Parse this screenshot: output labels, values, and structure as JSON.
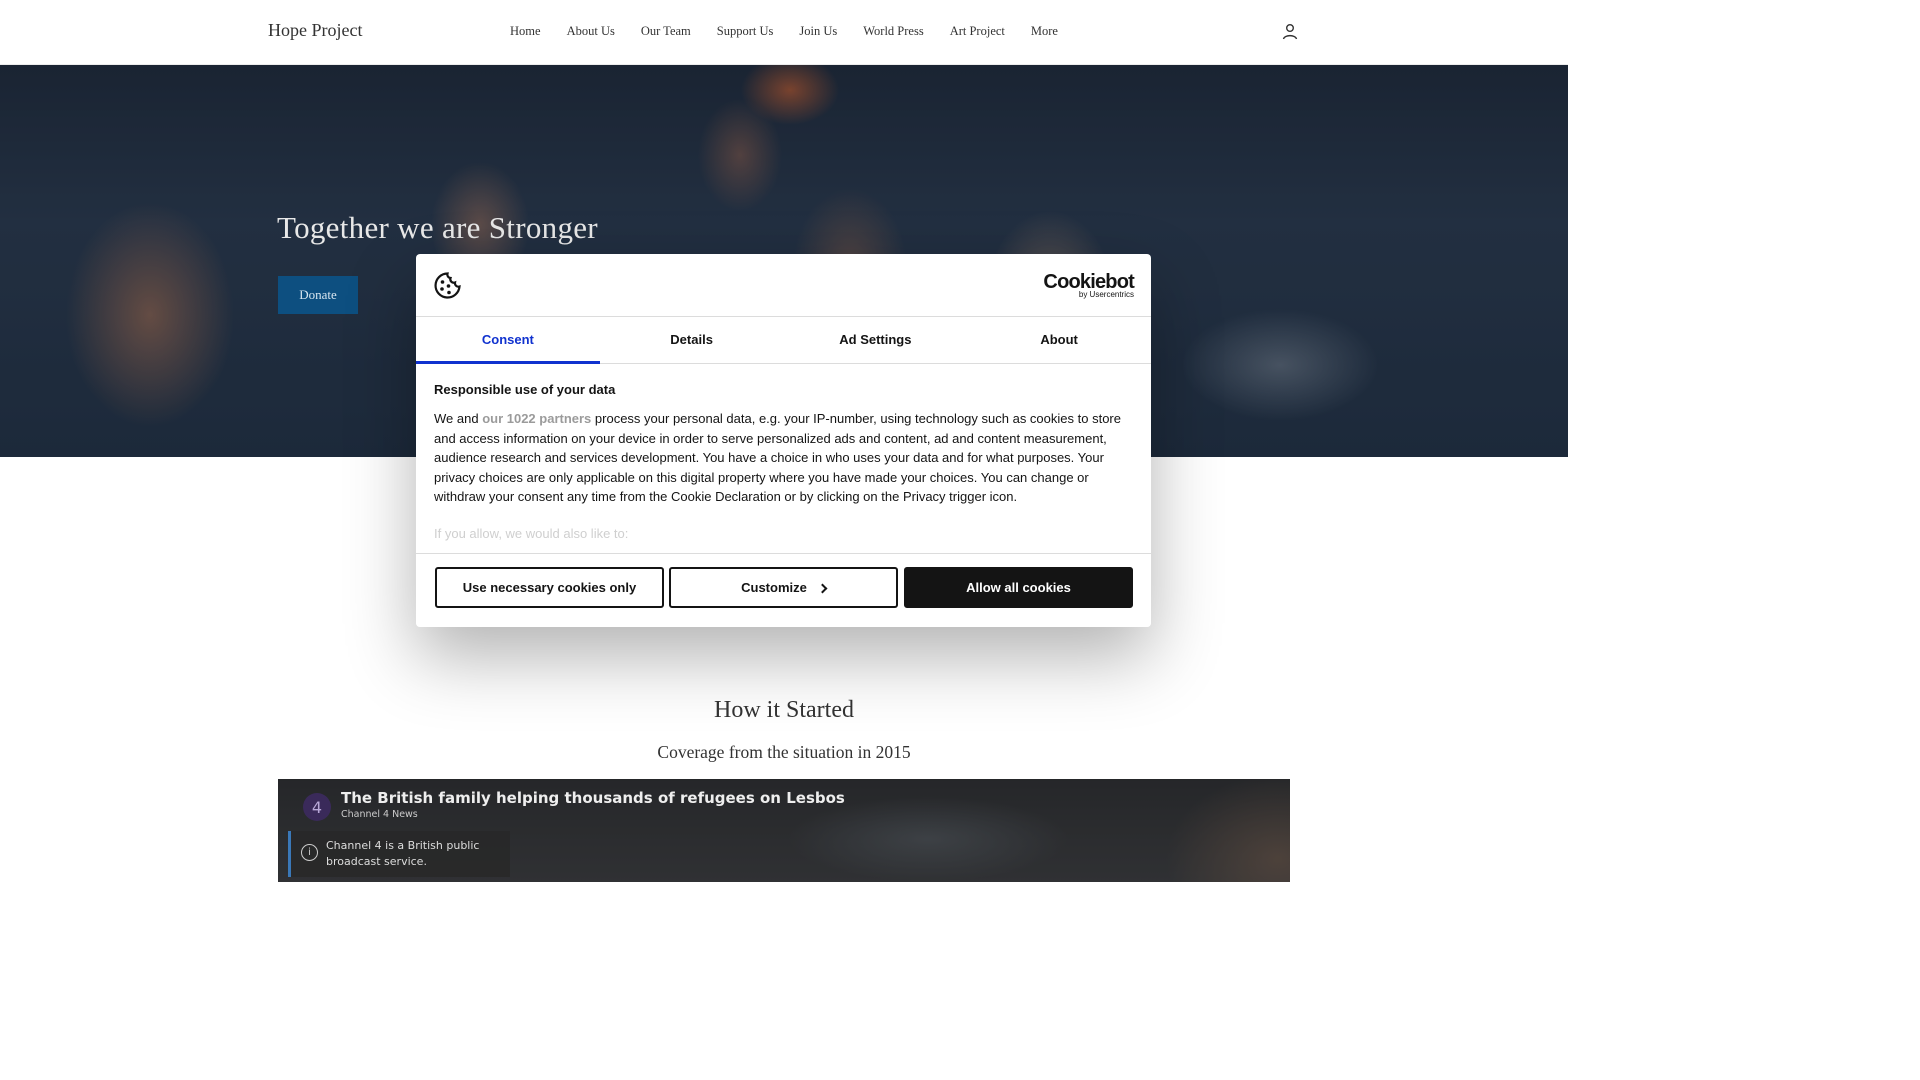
{
  "header": {
    "logo": "Hope Project",
    "nav": [
      "Home",
      "About Us",
      "Our Team",
      "Support Us",
      "Join Us",
      "World Press",
      "Art Project",
      "More"
    ]
  },
  "hero": {
    "title": "Together we are Stronger",
    "donate_label": "Donate"
  },
  "section": {
    "title": "How it Started",
    "subtitle": "Coverage from the situation in 2015"
  },
  "video": {
    "channel_logo": "4",
    "title": "The British family helping thousands of refugees on Lesbos",
    "channel": "Channel 4 News",
    "info": "Channel 4 is a British public broadcast service."
  },
  "cookie": {
    "brand": "Cookiebot",
    "brand_sub": "by Usercentrics",
    "tabs": [
      "Consent",
      "Details",
      "Ad Settings",
      "About"
    ],
    "active_tab": "Consent",
    "heading": "Responsible use of your data",
    "text_before": "We and ",
    "partners_link": "our 1022 partners",
    "text_after": " process your personal data, e.g. your IP-number, using technology such as cookies to store and access information on your device in order to serve personalized ads and content, ad and content measurement, audience research and services development. You have a choice in who uses your data and for what purposes. Your privacy choices are only applicable on this digital property where you have made your choices. You can change or withdraw your consent any time from the Cookie Declaration or by clicking on the Privacy trigger icon.",
    "faded_text": "If you allow, we would also like to:",
    "buttons": {
      "necessary": "Use necessary cookies only",
      "customize": "Customize",
      "allow": "Allow all cookies"
    }
  },
  "colors": {
    "accent": "#1032cf",
    "donate": "#0d4f80",
    "dark": "#141414"
  },
  "icons": {
    "user": "user-icon",
    "cookie": "cookie-icon",
    "info": "info-icon",
    "chevron": "chevron-right-icon"
  }
}
